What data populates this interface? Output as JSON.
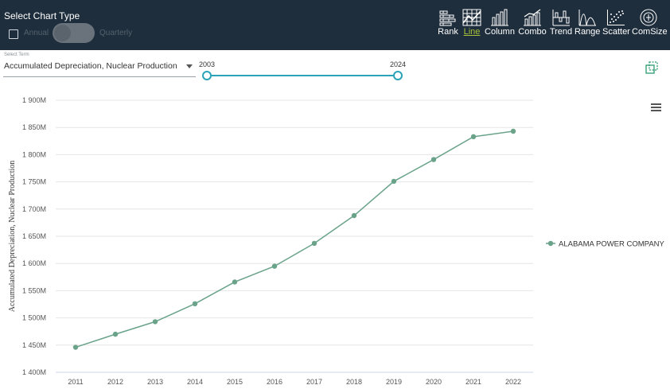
{
  "toolbar": {
    "title": "Select Chart Type",
    "annual_label": "Annual",
    "quarterly_label": "Quarterly",
    "chart_types": [
      {
        "label": "Rank",
        "icon": "rank-icon"
      },
      {
        "label": "Line",
        "icon": "line-chart-icon",
        "active": true
      },
      {
        "label": "Column",
        "icon": "column-chart-icon"
      },
      {
        "label": "Combo",
        "icon": "combo-chart-icon"
      },
      {
        "label": "Trend",
        "icon": "trend-chart-icon"
      },
      {
        "label": "Range",
        "icon": "range-chart-icon"
      },
      {
        "label": "Scatter",
        "icon": "scatter-chart-icon"
      },
      {
        "label": "ComSize",
        "icon": "comsize-icon"
      }
    ]
  },
  "controls": {
    "term_label": "Select Term",
    "term_value": "Accumulated Depreciation, Nuclear Production",
    "year_start": "2003",
    "year_end": "2024"
  },
  "colors": {
    "header_bg": "#1f2e3c",
    "series": "#6aa38a",
    "slider": "#2aa3b8",
    "active_type": "#a8c23a"
  },
  "chart_data": {
    "type": "line",
    "ylabel": "Accumulated Depreciation, Nuclear Production",
    "x": [
      "2011",
      "2012",
      "2013",
      "2014",
      "2015",
      "2016",
      "2017",
      "2018",
      "2019",
      "2020",
      "2021",
      "2022"
    ],
    "series": [
      {
        "name": "ALABAMA POWER COMPANY",
        "values": [
          1446,
          1470,
          1493,
          1526,
          1566,
          1595,
          1637,
          1688,
          1751,
          1791,
          1833,
          1843
        ]
      }
    ],
    "y_ticks": [
      "1 400M",
      "1 450M",
      "1 500M",
      "1 550M",
      "1 600M",
      "1 650M",
      "1 700M",
      "1 750M",
      "1 800M",
      "1 850M",
      "1 900M"
    ],
    "ylim": [
      1400,
      1900
    ],
    "grid": true,
    "legend_position": "right"
  }
}
